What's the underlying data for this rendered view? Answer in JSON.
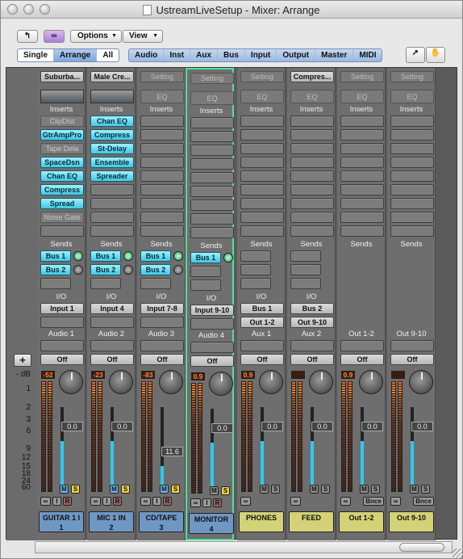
{
  "window": {
    "title": "UstreamLiveSetup - Mixer: Arrange"
  },
  "toolbar": {
    "back_icon": "back-arrow-icon",
    "link_icon": "link-icon",
    "options_label": "Options",
    "view_label": "View",
    "view_modes": [
      "Single",
      "Arrange",
      "All"
    ],
    "view_mode_selected": "Arrange",
    "filters": [
      "Audio",
      "Inst",
      "Aux",
      "Bus",
      "Input",
      "Output",
      "Master",
      "MIDI"
    ],
    "pointer_tool_icon": "arrow-pointer-icon",
    "hand_tool_icon": "hand-icon"
  },
  "mixer": {
    "add_button": "+",
    "db_label": "- dB",
    "scale": [
      "1",
      "2",
      "3",
      "6",
      "9",
      "12",
      "15",
      "18",
      "24",
      "60"
    ],
    "section_labels": {
      "inserts": "Inserts",
      "sends": "Sends",
      "io": "I/O",
      "eq": "EQ"
    },
    "channels": [
      {
        "setting": "Suburba...",
        "setting_active": true,
        "inserts": [
          "ClipDist",
          "GtrAmpPro",
          "Tape Dela",
          "SpaceDsn",
          "Chan EQ",
          "Compress",
          "Spread",
          "Noise Gate"
        ],
        "inserts_on": [
          false,
          true,
          false,
          true,
          true,
          true,
          true,
          false
        ],
        "sends": [
          {
            "name": "Bus 1",
            "on": true
          },
          {
            "name": "Bus 2",
            "on": false
          }
        ],
        "input": "Input 1",
        "output": "",
        "type": "Audio 1",
        "auto": "Off",
        "peak": "-52",
        "fader": "0.0",
        "fader_level": 0.6,
        "mute": true,
        "solo": true,
        "record": true,
        "input_mon": true,
        "name_line1": "GUITAR 1 I",
        "name_line2": "1",
        "color": "blue"
      },
      {
        "setting": "Male Cre...",
        "setting_active": true,
        "inserts": [
          "Chan EQ",
          "Compress",
          "St-Delay",
          "Ensemble",
          "Spreader"
        ],
        "inserts_on": [
          true,
          true,
          true,
          true,
          true
        ],
        "sends": [
          {
            "name": "Bus 1",
            "on": true
          },
          {
            "name": "Bus 2",
            "on": false
          }
        ],
        "input": "Input 4",
        "output": "",
        "type": "Audio 2",
        "auto": "Off",
        "peak": "-23",
        "fader": "0.0",
        "fader_level": 0.6,
        "mute": true,
        "solo": true,
        "record": true,
        "input_mon": true,
        "name_line1": "MIC 1 IN",
        "name_line2": "2",
        "color": "blue"
      },
      {
        "setting": "Setting",
        "setting_active": false,
        "inserts": [],
        "inserts_on": [],
        "sends": [
          {
            "name": "Bus 1",
            "on": true
          },
          {
            "name": "Bus 2",
            "on": false
          }
        ],
        "input": "Input 7-8",
        "output": "",
        "type": "Audio 3",
        "auto": "Off",
        "peak": "-83",
        "fader": "11.6",
        "fader_level": 0.3,
        "mute": true,
        "solo": true,
        "record": true,
        "input_mon": true,
        "name_line1": "CD/TAPE",
        "name_line2": "3",
        "color": "blue"
      },
      {
        "setting": "Setting",
        "setting_active": false,
        "inserts": [],
        "inserts_on": [],
        "sends": [
          {
            "name": "Bus 1",
            "on": true
          }
        ],
        "input": "Input 9-10",
        "output": "",
        "type": "Audio 4",
        "auto": "Off",
        "peak": "0.9",
        "fader": "0.0",
        "fader_level": 0.6,
        "mute": false,
        "solo": true,
        "record": true,
        "input_mon": true,
        "name_line1": "MONITOR",
        "name_line2": "4",
        "color": "blue",
        "selected": true
      },
      {
        "setting": "Setting",
        "setting_active": false,
        "inserts": [],
        "inserts_on": [],
        "sends": [],
        "input": "Bus 1",
        "output": "Out 1-2",
        "type": "Aux 1",
        "auto": "Off",
        "peak": "0.9",
        "fader": "0.0",
        "fader_level": 0.6,
        "mute": false,
        "solo": false,
        "record": false,
        "input_mon": false,
        "name_line1": "PHONES",
        "name_line2": "",
        "color": "yellow"
      },
      {
        "setting": "Compres...",
        "setting_active": true,
        "inserts": [],
        "inserts_on": [],
        "sends": [],
        "input": "Bus 2",
        "output": "Out 9-10",
        "type": "Aux 2",
        "auto": "Off",
        "peak": "",
        "fader": "0.0",
        "fader_level": 0.6,
        "mute": false,
        "solo": false,
        "record": false,
        "input_mon": false,
        "name_line1": "FEED",
        "name_line2": "",
        "color": "yellow"
      },
      {
        "setting": "Setting",
        "setting_active": false,
        "inserts": [],
        "inserts_on": [],
        "sends": [],
        "input": "",
        "output": "",
        "type": "Out 1-2",
        "auto": "Off",
        "peak": "0.9",
        "fader": "0.0",
        "fader_level": 0.6,
        "mute": false,
        "solo": false,
        "record": false,
        "input_mon": false,
        "bounce": "Bnce",
        "name_line1": "Out 1-2",
        "name_line2": "",
        "color": "yellow"
      },
      {
        "setting": "Setting",
        "setting_active": false,
        "inserts": [],
        "inserts_on": [],
        "sends": [],
        "input": "",
        "output": "",
        "type": "Out 9-10",
        "auto": "Off",
        "peak": "",
        "fader": "0.0",
        "fader_level": 0.6,
        "mute": false,
        "solo": false,
        "record": false,
        "input_mon": false,
        "bounce": "Bnce",
        "name_line1": "Out 9-10",
        "name_line2": "",
        "color": "yellow"
      }
    ]
  },
  "colors": {
    "selected_strip": "#4fe09a",
    "insert_on": "#3fc7e6",
    "audio_name": "#6f97c4",
    "aux_name": "#d3d277"
  }
}
